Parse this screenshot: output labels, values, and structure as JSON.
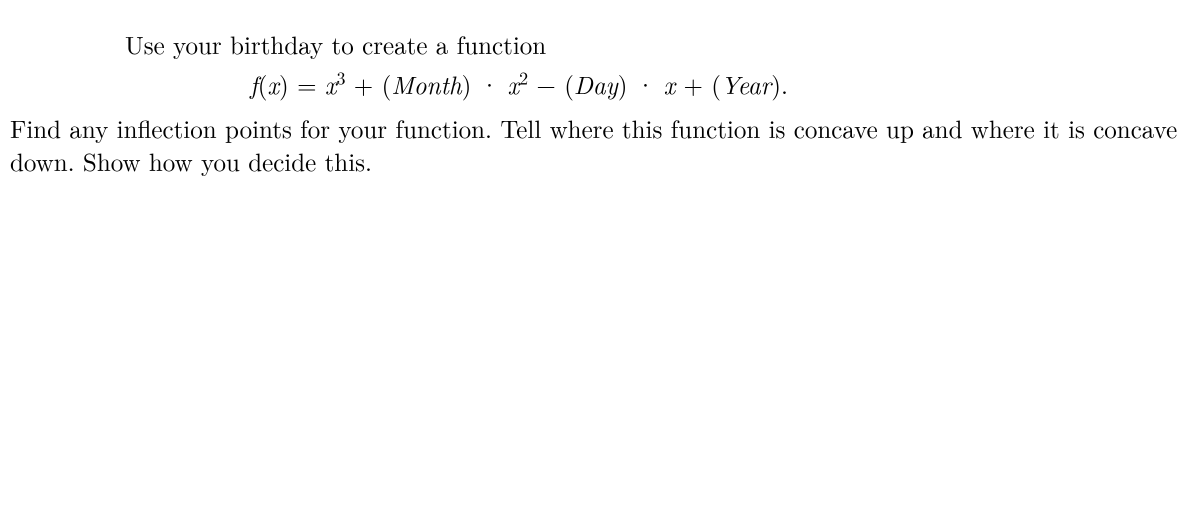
{
  "doc": {
    "line1": "Use your birthday to create a function",
    "equation": {
      "lhs_f": "f",
      "lhs_open": "(",
      "lhs_var": "x",
      "lhs_close": ")",
      "eq": " = ",
      "term1_var": "x",
      "term1_exp": "3",
      "plus1": " + (",
      "month_M": "M",
      "month_rest": "onth",
      "close1": ") · ",
      "term2_var": "x",
      "term2_exp": "2",
      "minus": " − (",
      "day_D": "D",
      "day_rest": "ay",
      "close2": ") · ",
      "term3_var": "x",
      "plus2": " + (",
      "year_Y": "Y",
      "year_rest": "ear",
      "close3": ").",
      "dot_suffix": ""
    },
    "para": "Find any inflection points for your function. Tell where this function is concave up and where it is concave down. Show how you decide this."
  }
}
